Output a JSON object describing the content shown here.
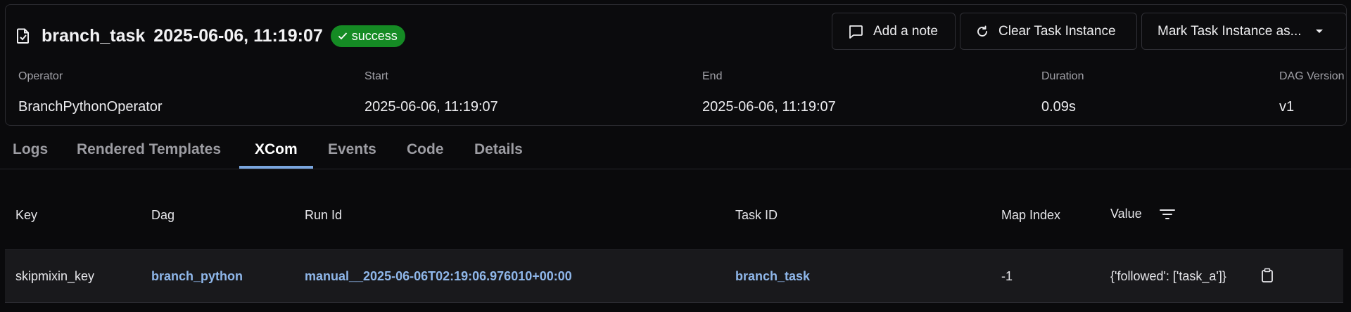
{
  "header": {
    "task_name": "branch_task",
    "run_date": "2025-06-06, 11:19:07",
    "status": "success",
    "status_color": "#158b24",
    "buttons": {
      "add_note": "Add a note",
      "clear": "Clear Task Instance",
      "mark": "Mark Task Instance as..."
    },
    "meta": {
      "operator_label": "Operator",
      "operator_value": "BranchPythonOperator",
      "start_label": "Start",
      "start_value": "2025-06-06, 11:19:07",
      "end_label": "End",
      "end_value": "2025-06-06, 11:19:07",
      "duration_label": "Duration",
      "duration_value": "0.09s",
      "version_label": "DAG Version",
      "version_value": "v1"
    }
  },
  "tabs": [
    {
      "label": "Logs"
    },
    {
      "label": "Rendered Templates"
    },
    {
      "label": "XCom",
      "active": true
    },
    {
      "label": "Events"
    },
    {
      "label": "Code"
    },
    {
      "label": "Details"
    }
  ],
  "table": {
    "columns": [
      "Key",
      "Dag",
      "Run Id",
      "Task ID",
      "Map Index",
      "Value"
    ],
    "rows": [
      {
        "key": "skipmixin_key",
        "dag": "branch_python",
        "run_id": "manual__2025-06-06T02:19:06.976010+00:00",
        "task_id": "branch_task",
        "map_index": "-1",
        "value": "{'followed': ['task_a']}"
      }
    ]
  },
  "colors": {
    "accent": "#7aa6df",
    "link": "#8fb7ea",
    "background": "#0a0a0c"
  }
}
